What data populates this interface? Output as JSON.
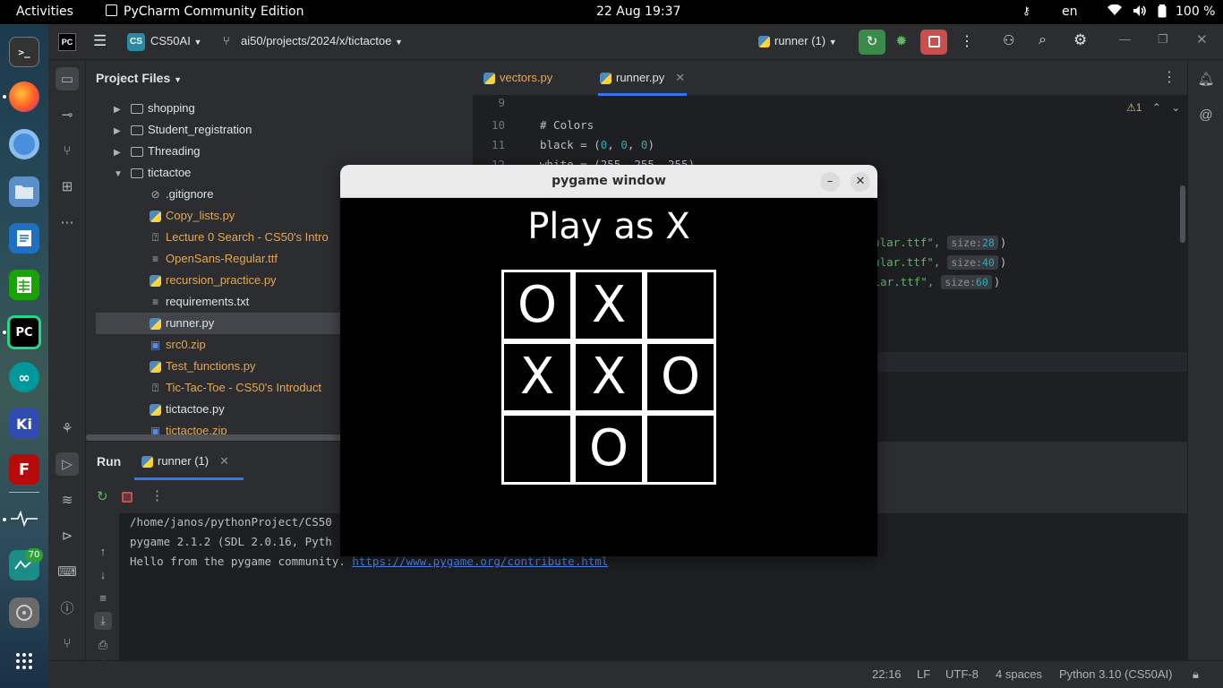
{
  "topbar": {
    "activities": "Activities",
    "app_name": "PyCharm Community Edition",
    "clock": "22 Aug  19:37",
    "lang": "en",
    "battery": "100 %"
  },
  "dock": {
    "items": [
      "terminal",
      "firefox",
      "chromium",
      "files",
      "writer",
      "calc",
      "pycharm",
      "arduino",
      "kicad",
      "filezilla",
      "system-monitor",
      "activity",
      "disk",
      "apps-grid"
    ],
    "badge": "70"
  },
  "toolbar": {
    "project_badge": "CS",
    "project": "CS50AI",
    "path": "ai50/projects/2024/x/tictactoe",
    "run_config": "runner (1)"
  },
  "project_panel": {
    "title": "Project Files",
    "rows": [
      {
        "name": "shopping",
        "type": "folder"
      },
      {
        "name": "Student_registration",
        "type": "folder"
      },
      {
        "name": "Threading",
        "type": "folder"
      },
      {
        "name": "tictactoe",
        "type": "folder-open"
      },
      {
        "name": ".gitignore",
        "type": "ignore"
      },
      {
        "name": "Copy_lists.py",
        "type": "py"
      },
      {
        "name": "Lecture 0 Search - CS50's Intro",
        "type": "unknown"
      },
      {
        "name": "OpenSans-Regular.ttf",
        "type": "text"
      },
      {
        "name": "recursion_practice.py",
        "type": "py"
      },
      {
        "name": "requirements.txt",
        "type": "text"
      },
      {
        "name": "runner.py",
        "type": "py"
      },
      {
        "name": "src0.zip",
        "type": "zip"
      },
      {
        "name": "Test_functions.py",
        "type": "py"
      },
      {
        "name": "Tic-Tac-Toe - CS50's Introduct",
        "type": "unknown"
      },
      {
        "name": "tictactoe.py",
        "type": "py"
      },
      {
        "name": "tictactoe.zip",
        "type": "zip"
      }
    ]
  },
  "editor": {
    "tabs": [
      "vectors.py",
      "runner.py"
    ],
    "warnings": "1",
    "lines": {
      "l9": "9",
      "l10": "10",
      "c10": "# Colors",
      "l11": "11",
      "c11a": "black = (",
      "c11b": "0",
      "c11c": ", ",
      "c11d": "0",
      "c11e": ", ",
      "c11f": "0",
      "c11g": ")",
      "l12": "12",
      "c12": "white = (255, 255, 255)",
      "s1": "egular.ttf\",",
      "h1k": "size:",
      "h1v": "28",
      "p1": ")",
      "s2": "egular.ttf\",",
      "h2k": "size:",
      "h2v": "40",
      "p2": ")",
      "s3": "ular.ttf\",",
      "h3k": "size:",
      "h3v": "60",
      "p3": ")"
    }
  },
  "run": {
    "title": "Run",
    "tab": "runner (1)",
    "lines": [
      "/home/janos/pythonProject/CS50",
      "pygame 2.1.2 (SDL 2.0.16, Pyth",
      "Hello from the pygame community. "
    ],
    "link": "https://www.pygame.org/contribute.html"
  },
  "status": {
    "position": "22:16",
    "line_sep": "LF",
    "encoding": "UTF-8",
    "indent": "4 spaces",
    "interpreter": "Python 3.10 (CS50AI)"
  },
  "pygame": {
    "window_title": "pygame window",
    "heading": "Play as X",
    "board": [
      "O",
      "X",
      "",
      "X",
      "X",
      "O",
      "",
      "O",
      ""
    ]
  }
}
